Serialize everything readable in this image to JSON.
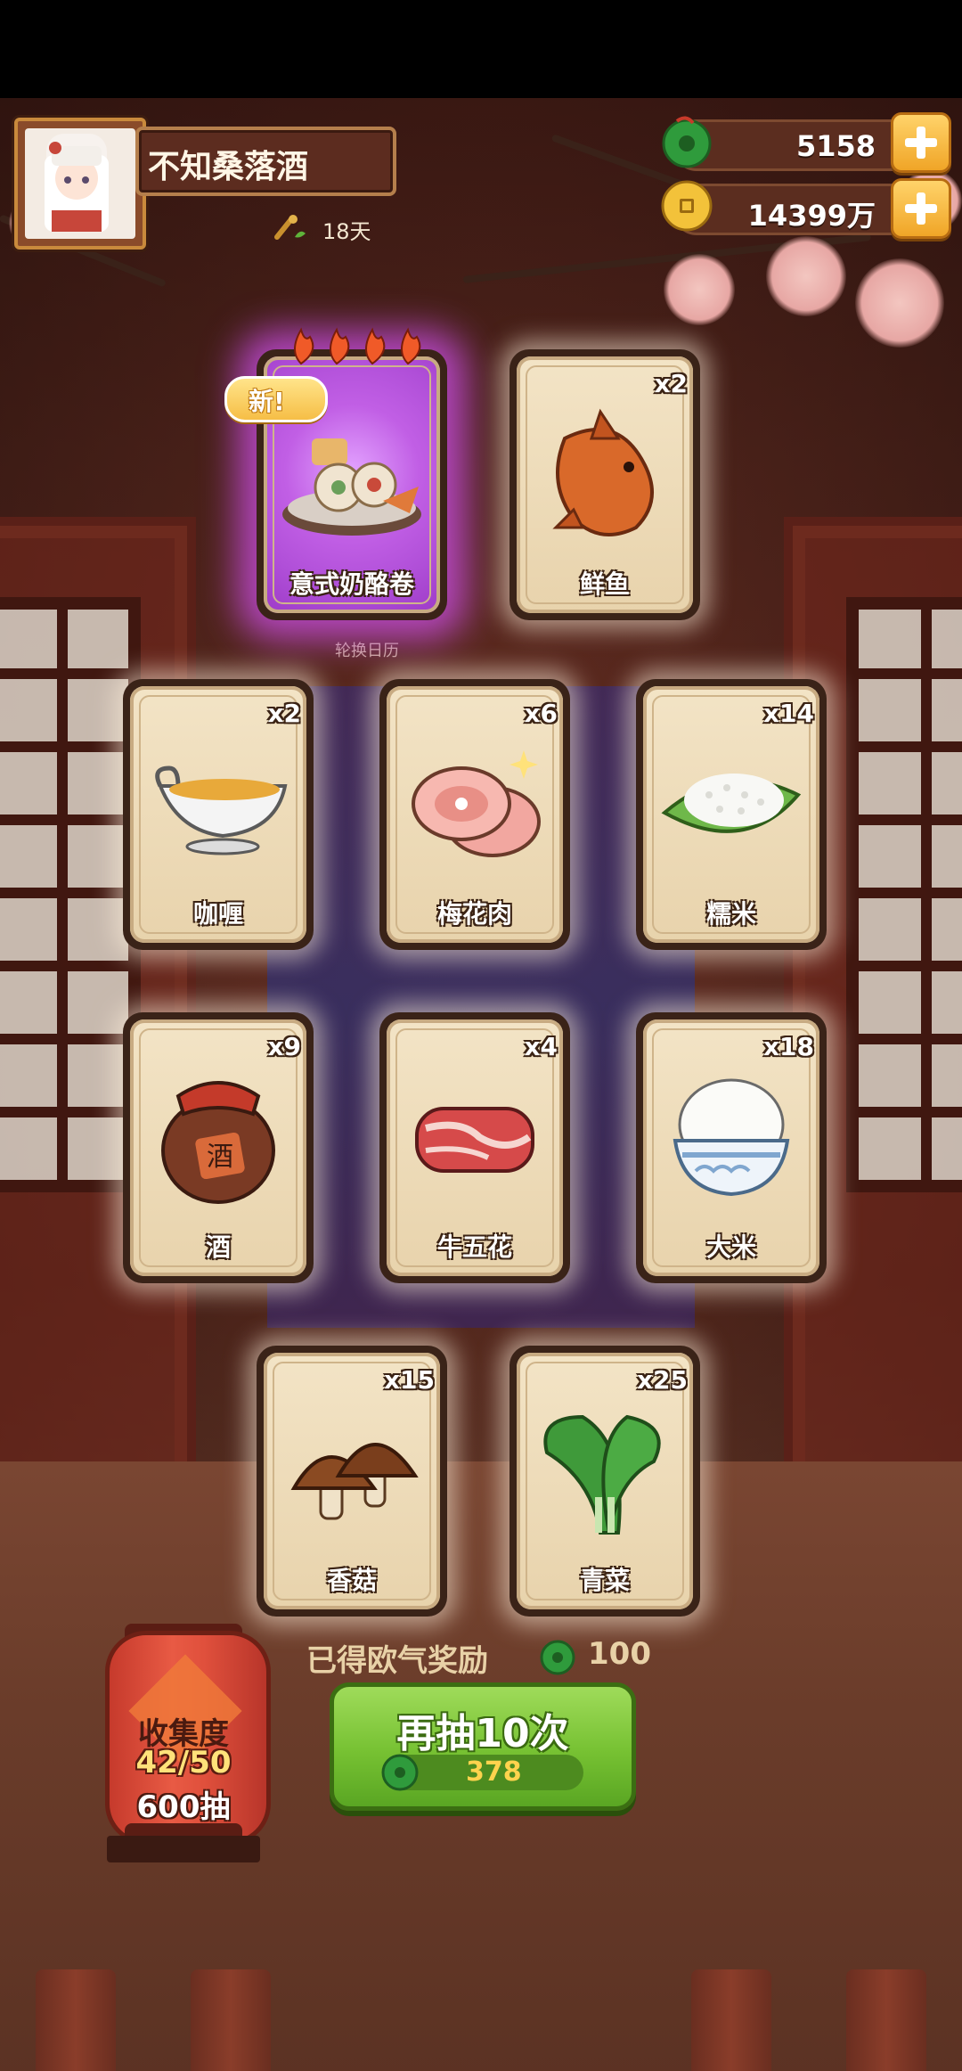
{
  "header": {
    "player_name": "不知桑落酒",
    "days": "18天",
    "jade": "5158",
    "coins": "14399万"
  },
  "icons": {
    "avatar": "chibi-chef-avatar",
    "days_icon": "scroll-sprout-icon",
    "jade_icon": "green-jade-icon",
    "coin_icon": "gold-coin-icon",
    "plus_icon": "plus-icon"
  },
  "background_label": "轮换日历",
  "cards": [
    {
      "label": "意式奶酪卷",
      "count": "",
      "rarity": "rare",
      "new": "新!"
    },
    {
      "label": "鲜鱼",
      "count": "x2"
    },
    {
      "label": "咖喱",
      "count": "x2"
    },
    {
      "label": "梅花肉",
      "count": "x6"
    },
    {
      "label": "糯米",
      "count": "x14"
    },
    {
      "label": "酒",
      "count": "x9"
    },
    {
      "label": "牛五花",
      "count": "x4"
    },
    {
      "label": "大米",
      "count": "x18"
    },
    {
      "label": "香菇",
      "count": "x15"
    },
    {
      "label": "青菜",
      "count": "x25"
    }
  ],
  "wine_jar_text": "酒",
  "collection": {
    "title": "收集度",
    "progress": "42/50",
    "draws": "600抽"
  },
  "reward": {
    "text": "已得欧气奖励",
    "value": "100"
  },
  "draw_button": {
    "label": "再抽10次",
    "cost": "378"
  },
  "colors": {
    "rare_glow": "#c15fe5",
    "button_green": "#76c132",
    "gold": "#f0a527"
  }
}
